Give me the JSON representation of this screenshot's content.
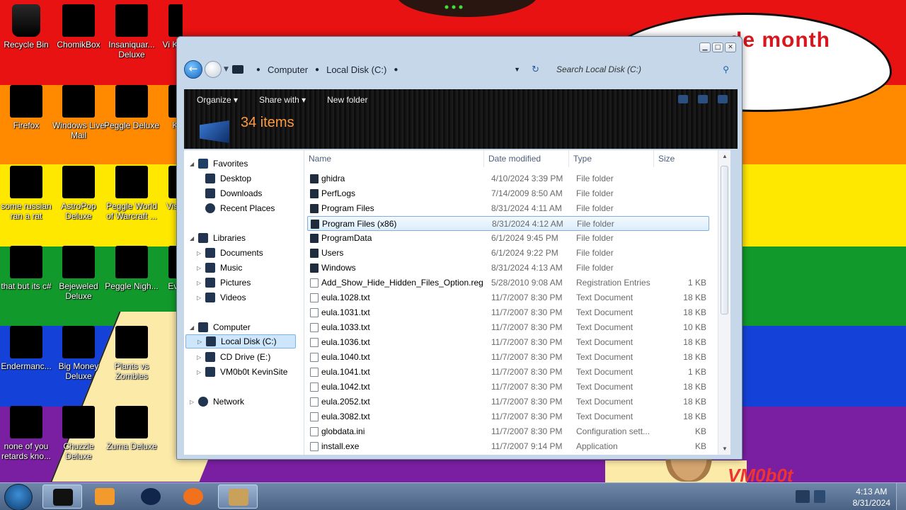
{
  "desktop": {
    "banner_text": "de month",
    "watermark": "VM0b0t",
    "icons": [
      {
        "label": "Recycle Bin"
      },
      {
        "label": "ChomikBox"
      },
      {
        "label": "Insaniquar... Deluxe"
      },
      {
        "label": "Vi Ke"
      },
      {
        "label": "Firefox"
      },
      {
        "label": "Windows Live Mail"
      },
      {
        "label": "Peggle Deluxe"
      },
      {
        "label": "Ke"
      },
      {
        "label": "some russian ran a rat"
      },
      {
        "label": "AstroPop Deluxe"
      },
      {
        "label": "Peggle World of Warcraft ..."
      },
      {
        "label": "Visu"
      },
      {
        "label": "that but its c#"
      },
      {
        "label": "Bejeweled Deluxe"
      },
      {
        "label": "Peggle Nigh..."
      },
      {
        "label": "Eve"
      },
      {
        "label": "Endermanc..."
      },
      {
        "label": "Big Money Deluxe"
      },
      {
        "label": "Plants vs Zombies"
      },
      {
        "label": "none of you retards kno..."
      },
      {
        "label": "Chuzzle Deluxe"
      },
      {
        "label": "Zuma Deluxe"
      }
    ]
  },
  "window": {
    "breadcrumb": {
      "root": "Computer",
      "current": "Local Disk (C:)"
    },
    "search_placeholder": "Search Local Disk (C:)",
    "toolbar": {
      "organize": "Organize",
      "share": "Share with",
      "new_folder": "New folder"
    },
    "item_count": "34 items",
    "nav": {
      "favorites": "Favorites",
      "desktop": "Desktop",
      "downloads": "Downloads",
      "recent": "Recent Places",
      "libraries": "Libraries",
      "documents": "Documents",
      "music": "Music",
      "pictures": "Pictures",
      "videos": "Videos",
      "computer": "Computer",
      "local_disk": "Local Disk (C:)",
      "cd_drive": "CD Drive (E:)",
      "kevinsite": "VM0b0t KevinSite",
      "network": "Network"
    },
    "columns": {
      "name": "Name",
      "date": "Date modified",
      "type": "Type",
      "size": "Size"
    },
    "files": [
      {
        "name": "ghidra",
        "date": "4/10/2024 3:39 PM",
        "type": "File folder",
        "size": ""
      },
      {
        "name": "PerfLogs",
        "date": "7/14/2009 8:50 AM",
        "type": "File folder",
        "size": ""
      },
      {
        "name": "Program Files",
        "date": "8/31/2024 4:11 AM",
        "type": "File folder",
        "size": ""
      },
      {
        "name": "Program Files (x86)",
        "date": "8/31/2024 4:12 AM",
        "type": "File folder",
        "size": ""
      },
      {
        "name": "ProgramData",
        "date": "6/1/2024 9:45 PM",
        "type": "File folder",
        "size": ""
      },
      {
        "name": "Users",
        "date": "6/1/2024 9:22 PM",
        "type": "File folder",
        "size": ""
      },
      {
        "name": "Windows",
        "date": "8/31/2024 4:13 AM",
        "type": "File folder",
        "size": ""
      },
      {
        "name": "Add_Show_Hide_Hidden_Files_Option.reg",
        "date": "5/28/2010 9:08 AM",
        "type": "Registration Entries",
        "size": "1 KB"
      },
      {
        "name": "eula.1028.txt",
        "date": "11/7/2007 8:30 PM",
        "type": "Text Document",
        "size": "18 KB"
      },
      {
        "name": "eula.1031.txt",
        "date": "11/7/2007 8:30 PM",
        "type": "Text Document",
        "size": "18 KB"
      },
      {
        "name": "eula.1033.txt",
        "date": "11/7/2007 8:30 PM",
        "type": "Text Document",
        "size": "10 KB"
      },
      {
        "name": "eula.1036.txt",
        "date": "11/7/2007 8:30 PM",
        "type": "Text Document",
        "size": "18 KB"
      },
      {
        "name": "eula.1040.txt",
        "date": "11/7/2007 8:30 PM",
        "type": "Text Document",
        "size": "18 KB"
      },
      {
        "name": "eula.1041.txt",
        "date": "11/7/2007 8:30 PM",
        "type": "Text Document",
        "size": "1 KB"
      },
      {
        "name": "eula.1042.txt",
        "date": "11/7/2007 8:30 PM",
        "type": "Text Document",
        "size": "18 KB"
      },
      {
        "name": "eula.2052.txt",
        "date": "11/7/2007 8:30 PM",
        "type": "Text Document",
        "size": "18 KB"
      },
      {
        "name": "eula.3082.txt",
        "date": "11/7/2007 8:30 PM",
        "type": "Text Document",
        "size": "18 KB"
      },
      {
        "name": "globdata.ini",
        "date": "11/7/2007 8:30 PM",
        "type": "Configuration sett...",
        "size": "KB"
      },
      {
        "name": "install.exe",
        "date": "11/7/2007 9:14 PM",
        "type": "Application",
        "size": "KB"
      }
    ]
  },
  "taskbar": {
    "time": "4:13 AM",
    "date": "8/31/2024"
  },
  "colors": {
    "accent": "#ff9a3e",
    "selection": "#cde6fb"
  }
}
